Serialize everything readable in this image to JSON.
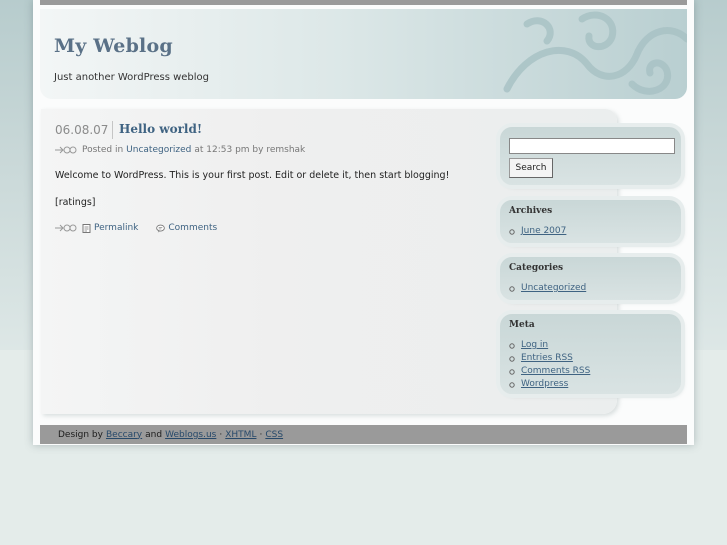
{
  "site": {
    "title": "My Weblog",
    "tagline": "Just another WordPress weblog"
  },
  "post": {
    "date": "06.08.07",
    "title": "Hello world!",
    "meta_prefix": "Posted in",
    "category": "Uncategorized",
    "meta_suffix": "at 12:53 pm by remshak",
    "body_paragraph_1": "Welcome to WordPress. This is your first post. Edit or delete it, then start blogging!",
    "body_paragraph_2": "[ratings]",
    "permalink_label": "Permalink",
    "comments_label": "Comments"
  },
  "sidebar": {
    "search": {
      "value": "",
      "button_label": "Search"
    },
    "archives": {
      "title": "Archives",
      "items": [
        "June 2007"
      ]
    },
    "categories": {
      "title": "Categories",
      "items": [
        "Uncategorized"
      ]
    },
    "meta": {
      "title": "Meta",
      "items": [
        "Log in",
        "Entries RSS",
        "Comments RSS",
        "Wordpress"
      ]
    }
  },
  "footer": {
    "design_by": "Design by",
    "designer": "Beccary",
    "and": "and",
    "partner": "Weblogs.us",
    "sep": "·",
    "xhtml": "XHTML",
    "css": "CSS"
  },
  "colors": {
    "accent_link": "#3f6382",
    "title": "#5a7187",
    "footer_bar": "#9a9a9a",
    "sidebar_box": "#d2dfdf"
  }
}
